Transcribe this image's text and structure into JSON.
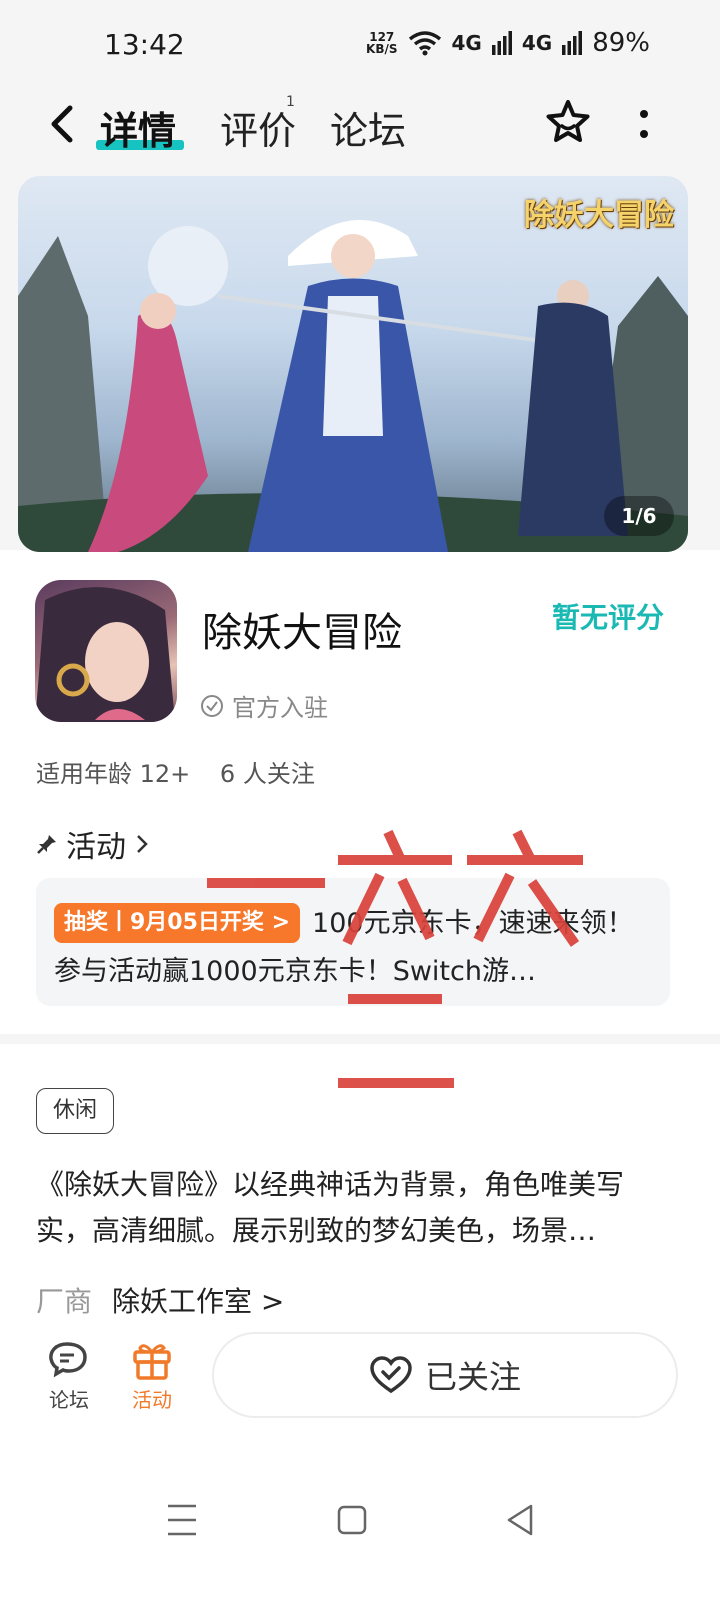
{
  "status_bar": {
    "time": "13:42",
    "net_speed_value": "127",
    "net_speed_unit": "KB/S",
    "sig1": "4G",
    "sig2": "4G",
    "battery": "89%"
  },
  "header": {
    "tabs": [
      {
        "label": "详情"
      },
      {
        "label": "评价",
        "badge": "1"
      },
      {
        "label": "论坛"
      }
    ]
  },
  "banner": {
    "logo_text": "除妖大冒险",
    "counter": "1/6"
  },
  "app": {
    "name": "除妖大冒险",
    "official_label": "官方入驻",
    "rating_label": "暂无评分",
    "age": "适用年龄 12+",
    "followers": "6 人关注"
  },
  "activity": {
    "title": "活动",
    "pill": "抽奖丨9月05日开奖 >",
    "text": "100元京东卡，速速来领！ 参与活动赢1000元京东卡！Switch游…"
  },
  "tag": "休闲",
  "description": "《除妖大冒险》以经典神话为背景，角色唯美写实，高清细腻。展示别致的梦幻美色，场景…",
  "vendor": {
    "label": "厂商",
    "name": "除妖工作室 >"
  },
  "bottom_bar": {
    "forum_label": "论坛",
    "activity_label": "活动",
    "follow_label": "已关注"
  },
  "colors": {
    "accent_teal": "#16c3c0",
    "activity_orange": "#f7772b",
    "annotation_red": "#d9423a"
  }
}
